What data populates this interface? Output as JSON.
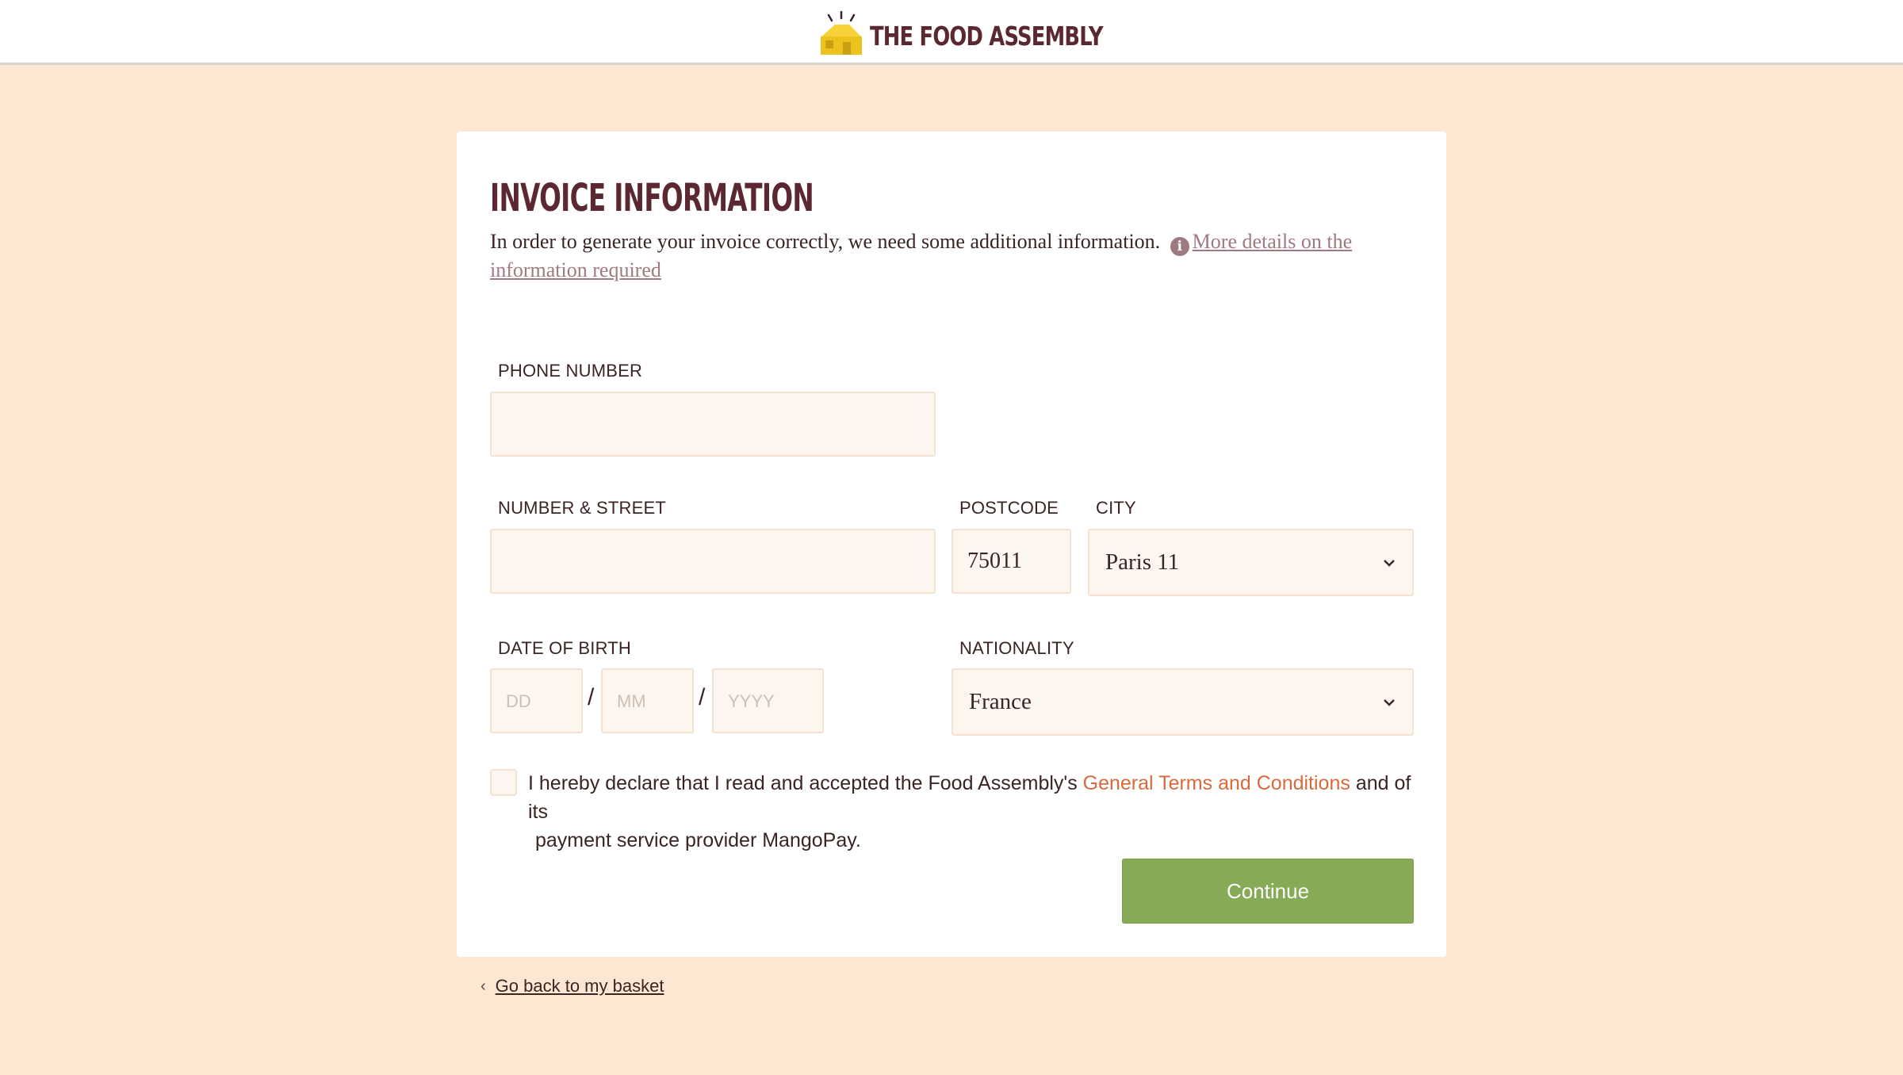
{
  "header": {
    "brand": "THE FOOD ASSEMBLY",
    "logo_icon": "food-assembly-house-logo"
  },
  "form": {
    "title": "INVOICE INFORMATION",
    "intro_text": "In order to generate your invoice correctly, we need some additional information.",
    "info_icon": "info-circle-icon",
    "details_link": "More details on the information required",
    "phone": {
      "label": "PHONE NUMBER",
      "value": "",
      "placeholder": ""
    },
    "street": {
      "label": "NUMBER & STREET",
      "value": "",
      "placeholder": ""
    },
    "postcode": {
      "label": "POSTCODE",
      "value": "75011"
    },
    "city": {
      "label": "CITY",
      "value": "Paris 11"
    },
    "dob": {
      "label": "DATE OF BIRTH",
      "day_placeholder": "DD",
      "month_placeholder": "MM",
      "year_placeholder": "YYYY",
      "separator": "/"
    },
    "nationality": {
      "label": "NATIONALITY",
      "value": "France"
    },
    "terms": {
      "checked": false,
      "text_before": "I hereby declare that I read and accepted the Food Assembly's ",
      "link": "General Terms and Conditions",
      "text_after": " and of its",
      "text_line2": "payment service provider MangoPay."
    },
    "continue_label": "Continue"
  },
  "footer": {
    "back_link": "Go back to my basket"
  },
  "colors": {
    "background": "#fde6d2",
    "brand": "#5b2730",
    "accent_link": "#d86a3c",
    "button": "#86aa55"
  }
}
